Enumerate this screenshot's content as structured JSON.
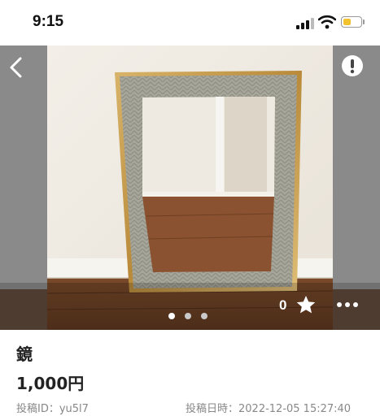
{
  "status_bar": {
    "time": "9:15",
    "icons": [
      "signal-icon",
      "wifi-icon",
      "battery-icon"
    ],
    "battery_color": "#f2c230"
  },
  "photo": {
    "subject": "mirror",
    "nav_icons": [
      "back-arrow-icon",
      "report-icon"
    ],
    "like_count": "0",
    "like_icon": "star-icon",
    "more_icon": "more-dots-icon",
    "carousel": {
      "total": 3,
      "current": 1
    }
  },
  "item": {
    "title": "鏡",
    "price": "1,000円",
    "poster_label": "投稿ID：yu5l7",
    "posted_label": "投稿日時：2022-12-05 15:27:40"
  }
}
